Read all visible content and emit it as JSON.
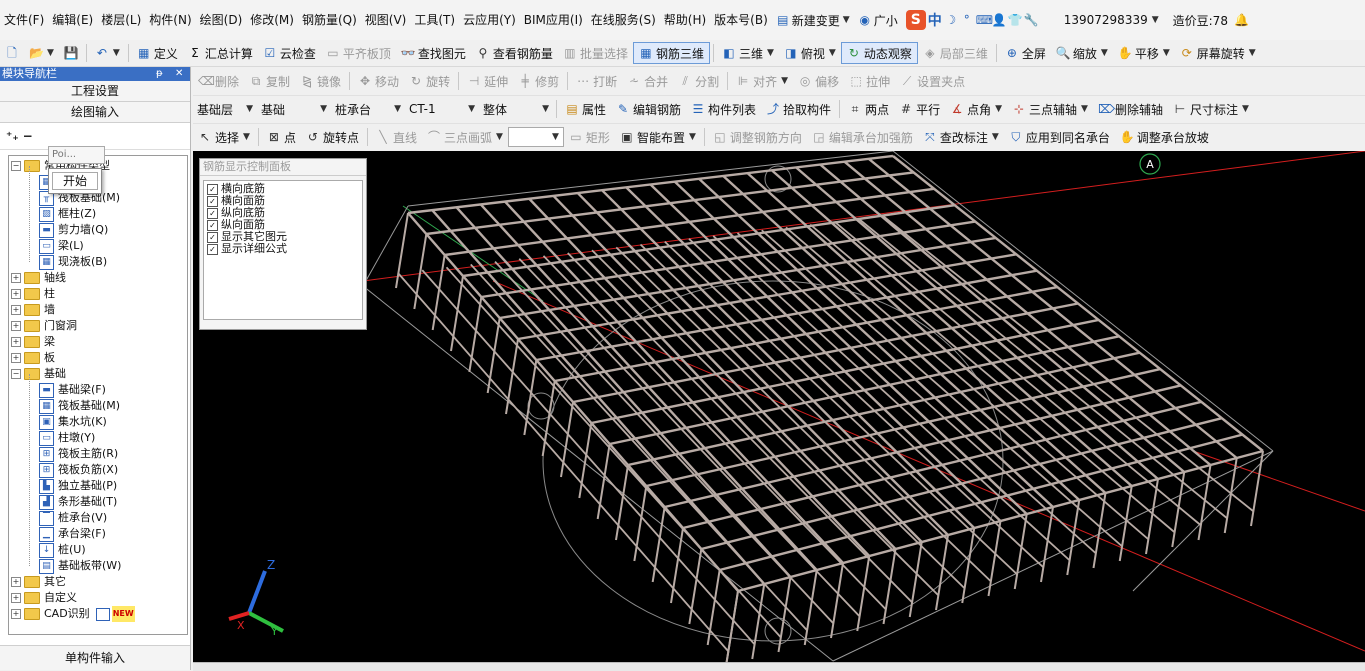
{
  "menubar": {
    "items": [
      "文件(F)",
      "编辑(E)",
      "楼层(L)",
      "构件(N)",
      "绘图(D)",
      "修改(M)",
      "钢筋量(Q)",
      "视图(V)",
      "工具(T)",
      "云应用(Y)",
      "BIM应用(I)",
      "在线服务(S)",
      "帮助(H)",
      "版本号(B)"
    ],
    "new_change": "新建变更",
    "guangxiao": "广小",
    "ime_cn": "中",
    "phone": "13907298339",
    "bean_label": "造价豆:78"
  },
  "toolbar1": {
    "define": "定义",
    "sum_calc": "汇总计算",
    "cloud_check": "云检查",
    "flat_top": "平齐板顶",
    "find_elem": "查找图元",
    "view_rebar_qty": "查看钢筋量",
    "batch_select": "批量选择",
    "rebar_3d": "钢筋三维",
    "three_d": "三维",
    "top_view": "俯视",
    "dynamic_view": "动态观察",
    "local_3d": "局部三维",
    "fullscreen": "全屏",
    "zoom": "缩放",
    "pan": "平移",
    "screen_rotate": "屏幕旋转"
  },
  "nav": {
    "title": "模块导航栏",
    "project_settings": "工程设置",
    "drawing_input": "绘图输入",
    "single_input": "单构件输入",
    "tooltip": "Poi...",
    "popup_start": "开始",
    "tree": [
      {
        "label": "常用构件类型",
        "type": "folder-open"
      },
      {
        "label": "柱(Z)",
        "type": "leaf"
      },
      {
        "label": "筏板基础(M)",
        "type": "leaf"
      },
      {
        "label": "框柱(Z)",
        "type": "leaf"
      },
      {
        "label": "剪力墙(Q)",
        "type": "leaf"
      },
      {
        "label": "梁(L)",
        "type": "leaf"
      },
      {
        "label": "现浇板(B)",
        "type": "leaf"
      },
      {
        "label": "轴线",
        "type": "folder"
      },
      {
        "label": "柱",
        "type": "folder"
      },
      {
        "label": "墙",
        "type": "folder"
      },
      {
        "label": "门窗洞",
        "type": "folder"
      },
      {
        "label": "梁",
        "type": "folder"
      },
      {
        "label": "板",
        "type": "folder"
      },
      {
        "label": "基础",
        "type": "folder-open"
      },
      {
        "label": "基础梁(F)",
        "type": "leaf"
      },
      {
        "label": "筏板基础(M)",
        "type": "leaf"
      },
      {
        "label": "集水坑(K)",
        "type": "leaf"
      },
      {
        "label": "柱墩(Y)",
        "type": "leaf"
      },
      {
        "label": "筏板主筋(R)",
        "type": "leaf"
      },
      {
        "label": "筏板负筋(X)",
        "type": "leaf"
      },
      {
        "label": "独立基础(P)",
        "type": "leaf"
      },
      {
        "label": "条形基础(T)",
        "type": "leaf"
      },
      {
        "label": "桩承台(V)",
        "type": "leaf"
      },
      {
        "label": "承台梁(F)",
        "type": "leaf"
      },
      {
        "label": "桩(U)",
        "type": "leaf"
      },
      {
        "label": "基础板带(W)",
        "type": "leaf"
      },
      {
        "label": "其它",
        "type": "folder"
      },
      {
        "label": "自定义",
        "type": "folder"
      },
      {
        "label": "CAD识别",
        "type": "folder"
      }
    ],
    "new_badge": "NEW"
  },
  "edit_toolbar": {
    "delete": "删除",
    "copy": "复制",
    "mirror": "镜像",
    "move": "移动",
    "rotate": "旋转",
    "extend": "延伸",
    "trim": "修剪",
    "break": "打断",
    "merge": "合并",
    "split": "分割",
    "align": "对齐",
    "offset": "偏移",
    "stretch": "拉伸",
    "set_grip": "设置夹点"
  },
  "layer_toolbar": {
    "floor": "基础层",
    "category": "基础",
    "element_type": "桩承台",
    "element": "CT-1",
    "scope": "整体",
    "properties": "属性",
    "edit_rebar": "编辑钢筋",
    "element_list": "构件列表",
    "pick_element": "拾取构件",
    "two_points": "两点",
    "parallel": "平行",
    "point_angle": "点角",
    "three_point_aux": "三点辅轴",
    "delete_aux": "删除辅轴",
    "dim_label": "尺寸标注"
  },
  "draw_toolbar": {
    "select": "选择",
    "point": "点",
    "rotate_point": "旋转点",
    "line": "直线",
    "three_point_arc": "三点画弧",
    "rect": "矩形",
    "smart_layout": "智能布置",
    "adjust_rebar_dir": "调整钢筋方向",
    "edit_cap_rebar": "编辑承台加强筋",
    "modify_label": "查改标注",
    "apply_same_cap": "应用到同名承台",
    "adjust_cap_slope": "调整承台放坡"
  },
  "rebar_panel": {
    "title": "钢筋显示控制面板",
    "options": [
      {
        "label": "横向底筋",
        "checked": true
      },
      {
        "label": "横向面筋",
        "checked": true
      },
      {
        "label": "纵向底筋",
        "checked": true
      },
      {
        "label": "纵向面筋",
        "checked": true
      },
      {
        "label": "显示其它图元",
        "checked": true
      },
      {
        "label": "显示详细公式",
        "checked": true
      }
    ]
  },
  "viewport": {
    "axis_marker": "A",
    "axes": {
      "z": "Z",
      "x": "X",
      "y": "Y"
    }
  },
  "colors": {
    "viewport_bg": "#000000",
    "rebar": "#b8aba5",
    "outline": "#9a9a9a",
    "grid_line_red": "#d41e1e",
    "grid_line_green": "#2fa84f",
    "nav_title_bg": "#3a6fc4"
  }
}
